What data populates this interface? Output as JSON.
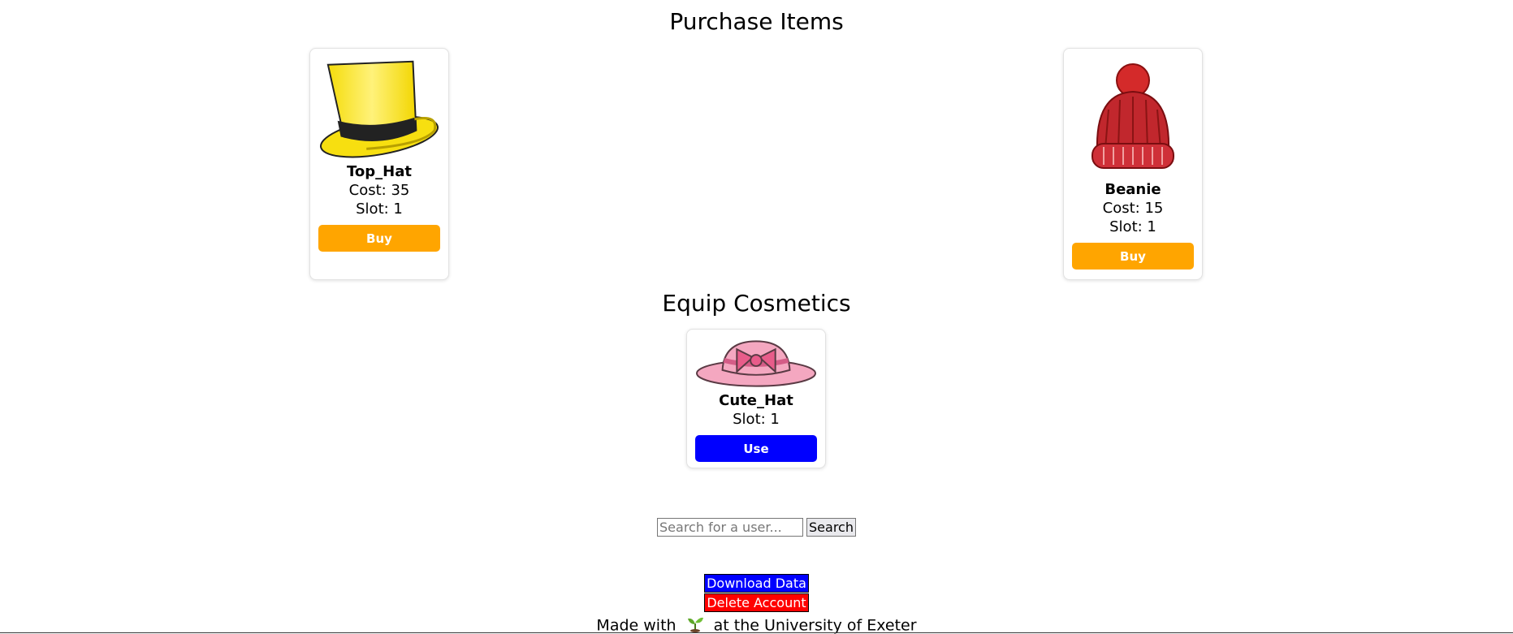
{
  "purchase": {
    "title": "Purchase Items",
    "items": [
      {
        "name": "Top_Hat",
        "cost": "Cost: 35",
        "slot": "Slot: 1",
        "button": "Buy",
        "icon": "top-hat-icon",
        "color": "#ffe21e"
      },
      {
        "name": "Beanie",
        "cost": "Cost: 15",
        "slot": "Slot: 1",
        "button": "Buy",
        "icon": "beanie-icon",
        "color": "#c1272d"
      }
    ],
    "button_color": "#ffa500"
  },
  "equip": {
    "title": "Equip Cosmetics",
    "items": [
      {
        "name": "Cute_Hat",
        "slot": "Slot: 1",
        "button": "Use",
        "icon": "cute-hat-icon",
        "color": "#f4a7c0"
      }
    ],
    "button_color": "#0000ff"
  },
  "search": {
    "placeholder": "Search for a user...",
    "button": "Search"
  },
  "account": {
    "download": "Download Data",
    "delete": "Delete Account"
  },
  "footer": {
    "prefix": "Made with",
    "suffix": "at the University of Exeter",
    "icon": "sprout-icon"
  }
}
